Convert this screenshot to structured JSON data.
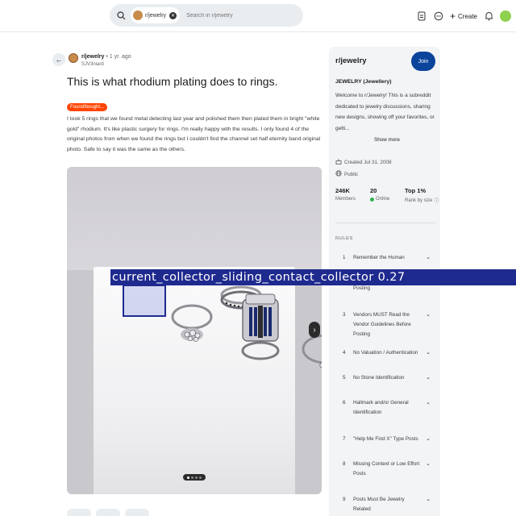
{
  "topbar": {
    "chip_label": "r/jewelry",
    "search_placeholder": "Search in r/jewelry",
    "create_label": "Create"
  },
  "post": {
    "subreddit": "r/jewelry",
    "time_ago": "• 1 yr. ago",
    "author": "SJV3niard",
    "title": "This is what rhodium plating does to rings.",
    "flair": "Found/bought...",
    "body": "I took 5 rings that we found metal detecting last year and polished them then plated them in bright \"white gold\" rhodium. It's like plastic surgery for rings. I'm really happy with the results. I only found 4 of the original photos from when we found the rings but I couldn't find the channel set half eternity band original photo. Safe to say it was the same as the others.",
    "image_pager": {
      "count": 4,
      "active": 0
    }
  },
  "detection": {
    "label": "current_collector_sliding_contact_collector",
    "score": "0.27"
  },
  "sidebar": {
    "name": "r/jewelry",
    "join_label": "Join",
    "title": "JEWELRY (Jewellery)",
    "description": "Welcome to r/Jewelry! This is a subreddit dedicated to jewelry discussions, sharing new designs, showing off your favorites, or getti...",
    "show_more": "Show more",
    "created": "Created Jul 31, 2008",
    "visibility": "Public",
    "stats": [
      {
        "value": "246K",
        "label": "Members"
      },
      {
        "value": "20",
        "label": "Online"
      },
      {
        "value": "Top 1%",
        "label": "Rank by size"
      }
    ],
    "rules_header": "RULES",
    "rules": [
      {
        "n": "1",
        "text": "Remember the Human"
      },
      {
        "n": "2",
        "text": "Read the Rules Before Posting"
      },
      {
        "n": "3",
        "text": "Vendors MUST Read the Vendor Guidelines Before Posting"
      },
      {
        "n": "4",
        "text": "No Valuation / Authentication"
      },
      {
        "n": "5",
        "text": "No Stone Identification"
      },
      {
        "n": "6",
        "text": "Hallmark and/or General Identification"
      },
      {
        "n": "7",
        "text": "\"Help Me Find X\" Type Posts"
      },
      {
        "n": "8",
        "text": "Missing Context or Low Effort Posts"
      },
      {
        "n": "9",
        "text": "Posts Must Be Jewelry Related"
      }
    ]
  }
}
